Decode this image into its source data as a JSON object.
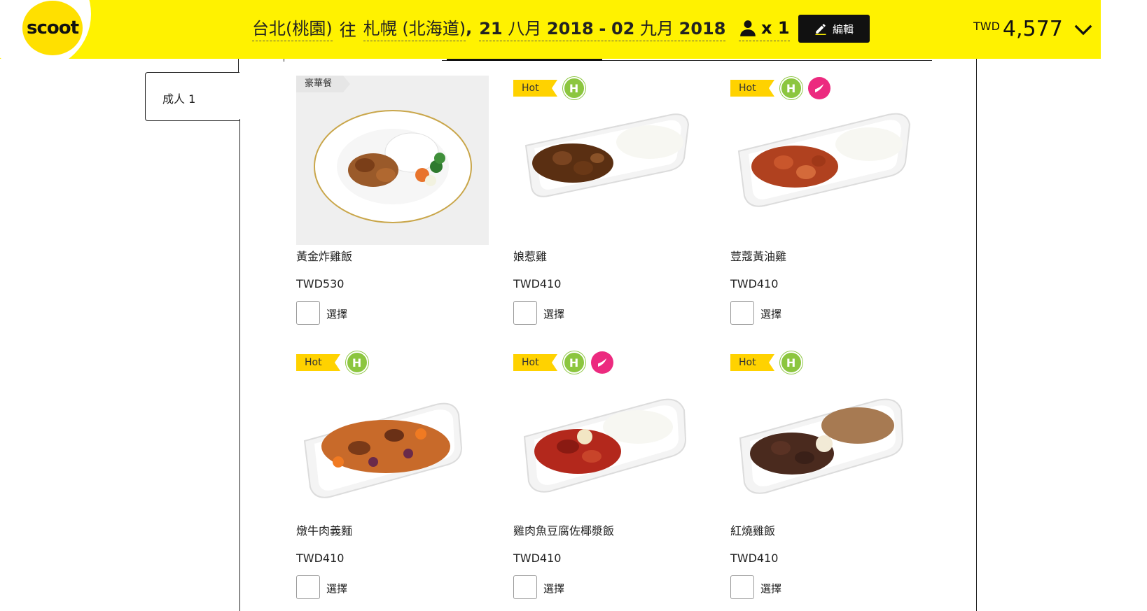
{
  "header": {
    "logo_text": "scoot",
    "route": {
      "origin": "台北(桃園)",
      "to_word": "往",
      "destination": "札幌 (北海道)",
      "comma": ",",
      "depart_day": "21",
      "depart_month": "八月",
      "depart_year": "2018",
      "dash": "-",
      "return_day": "02",
      "return_month": "九月",
      "return_year": "2018"
    },
    "pax_count": "x 1",
    "edit_label": "編輯",
    "total_currency": "TWD",
    "total_amount": "4,577"
  },
  "sidebar": {
    "pax_tab_label": "成人 1"
  },
  "meals": [
    {
      "badge": "豪華餐",
      "name": "黃金炸雞飯",
      "price": "TWD530",
      "select_label": "選擇",
      "hot": false,
      "halal": false,
      "spicy": false,
      "selected": false
    },
    {
      "badge": "Hot",
      "name": "娘惹雞",
      "price": "TWD410",
      "select_label": "選擇",
      "hot": true,
      "halal": true,
      "spicy": false,
      "selected": false
    },
    {
      "badge": "Hot",
      "name": "荳蔻黃油雞",
      "price": "TWD410",
      "select_label": "選擇",
      "hot": true,
      "halal": true,
      "spicy": true,
      "selected": false
    },
    {
      "badge": "Hot",
      "name": "燉牛肉義麵",
      "price": "TWD410",
      "select_label": "選擇",
      "hot": true,
      "halal": true,
      "spicy": false,
      "selected": false
    },
    {
      "badge": "Hot",
      "name": "雞肉魚豆腐佐椰漿飯",
      "price": "TWD410",
      "select_label": "選擇",
      "hot": true,
      "halal": true,
      "spicy": true,
      "selected": false
    },
    {
      "badge": "Hot",
      "name": "紅燒雞飯",
      "price": "TWD410",
      "select_label": "選擇",
      "hot": true,
      "halal": true,
      "spicy": false,
      "selected": false
    }
  ],
  "icons": {
    "halal": "H",
    "spicy": "chili-icon",
    "pax": "person-icon",
    "edit": "pencil-icon",
    "expand": "chevron-down-icon"
  },
  "colors": {
    "brand_yellow": "#fff200",
    "hot_tag": "#ffd200",
    "halal_green": "#8cc63f",
    "spicy_pink": "#ec2a7f"
  }
}
